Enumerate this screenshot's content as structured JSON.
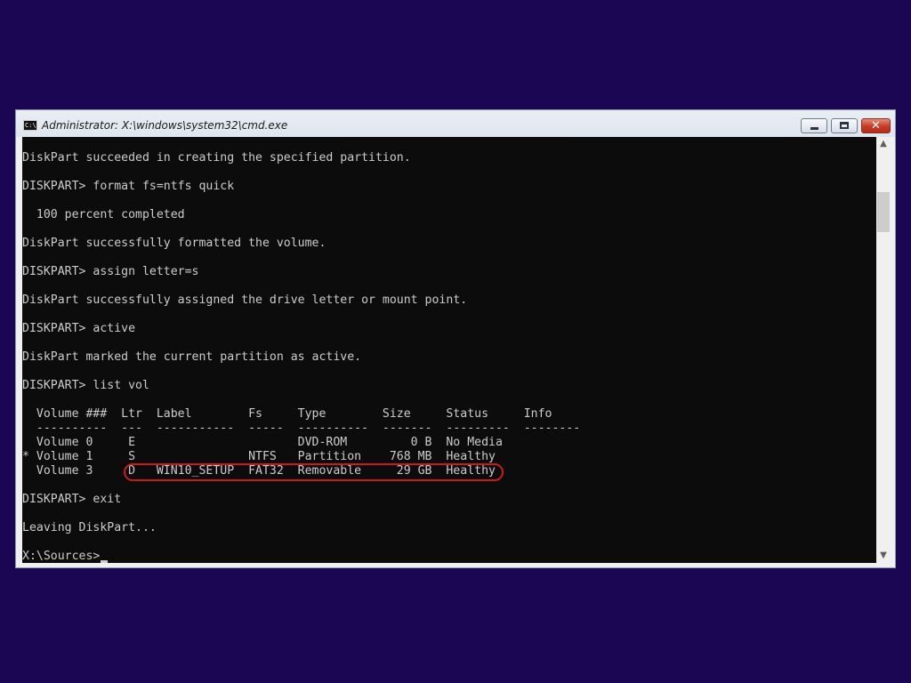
{
  "window": {
    "title": "Administrator: X:\\windows\\system32\\cmd.exe",
    "icon": "cmd-icon",
    "icon_text": "C:\\",
    "buttons": {
      "minimize": "minimize-icon",
      "maximize": "maximize-icon",
      "close": "close-icon",
      "close_glyph": "✕"
    }
  },
  "console": {
    "lines": [
      "DiskPart succeeded in creating the specified partition.",
      "DISKPART> format fs=ntfs quick",
      "  100 percent completed",
      "DiskPart successfully formatted the volume.",
      "DISKPART> assign letter=s",
      "DiskPart successfully assigned the drive letter or mount point.",
      "DISKPART> active",
      "DiskPart marked the current partition as active.",
      "DISKPART> list vol",
      "  Volume ###  Ltr  Label        Fs     Type        Size     Status     Info",
      "  ----------  ---  -----------  -----  ----------  -------  ---------  --------",
      "  Volume 0     E                       DVD-ROM         0 B  No Media",
      "* Volume 1     S                NTFS   Partition    768 MB  Healthy",
      "  Volume 3     D   WIN10_SETUP  FAT32  Removable     29 GB  Healthy",
      "DISKPART> exit",
      "Leaving DiskPart...",
      "X:\\Sources>"
    ]
  },
  "colors": {
    "desktop": "#1b0653",
    "console_bg": "#0c0c0c",
    "console_text": "#cccccc",
    "highlight": "#cc1a1a"
  }
}
